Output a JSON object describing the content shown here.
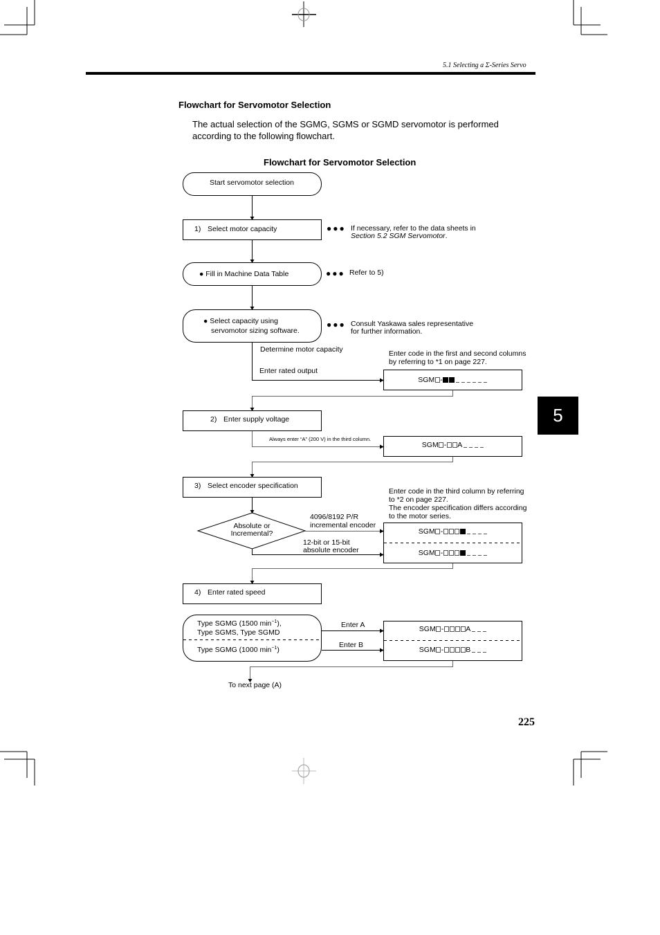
{
  "header": {
    "running_title": "5.1 Selecting a Σ-Series Servo"
  },
  "section_title": "Flowchart for Servomotor Selection",
  "intro_text": "The actual selection of the SGMG, SGMS or SGMD servomotor is performed according to the following flowchart.",
  "flowchart": {
    "title": "Flowchart for Servomotor Selection",
    "start": "Start servomotor selection",
    "step1": {
      "number": "1)",
      "label": "Select motor capacity",
      "note_line1": "If necessary, refer to the data sheets in",
      "note_line2_italic": "Section 5.2 SGM Servomotor",
      "note_line2_suffix": "."
    },
    "fill_table": {
      "label": "Fill in Machine Data Table",
      "note": "Refer to 5)"
    },
    "sizing": {
      "line1": "Select capacity using",
      "line2": "servomotor sizing software.",
      "note_line1": "Consult Yaskawa sales representative",
      "note_line2": "for further information."
    },
    "determine_capacity": "Determine motor capacity",
    "enter_rated_output": "Enter rated output",
    "code_note1_line1": "Enter code in the first and second columns",
    "code_note1_line2": "by referring to *1 on page 227.",
    "code1": {
      "prefix": "SGM",
      "pattern": "sq-fs,fs,us,us,us,us,us,us"
    },
    "step2": {
      "number": "2)",
      "label": "Enter supply voltage"
    },
    "voltage_note": "Always enter  “A” (200 V) in the third column.",
    "code2": {
      "prefix": "SGM",
      "letter": "A"
    },
    "step3": {
      "number": "3)",
      "label": "Select encoder specification"
    },
    "encoder_note": {
      "line1": "Enter code in the third column by referring",
      "line2": "to *2 on page 227.",
      "line3": "The encoder specification differs according",
      "line4": "to the motor series."
    },
    "decision": {
      "line1": "Absolute or",
      "line2": "Incremental?"
    },
    "incremental_label": {
      "line1": "4096/8192 P/R",
      "line2": "incremental encoder"
    },
    "absolute_label": {
      "line1": "12-bit or 15-bit",
      "line2": "absolute encoder"
    },
    "code3": {
      "prefix": "SGM"
    },
    "step4": {
      "number": "4)",
      "label": "Enter rated speed"
    },
    "speed_options": {
      "option_a_line1_pre": "Type SGMG (1500 min",
      "option_a_line1_sup": "−1",
      "option_a_line1_post": "),",
      "option_a_line2": "Type SGMS, Type SGMD",
      "option_b_pre": "Type SGMG (1000 min",
      "option_b_sup": "−1",
      "option_b_post": ")"
    },
    "enter_a": "Enter A",
    "enter_b": "Enter B",
    "code4": {
      "prefix": "SGM",
      "letter_a": "A",
      "letter_b": "B"
    },
    "next_page": "To next page (A)",
    "bullet_dots": "●●●"
  },
  "chapter_tab": "5",
  "page_number": "225"
}
